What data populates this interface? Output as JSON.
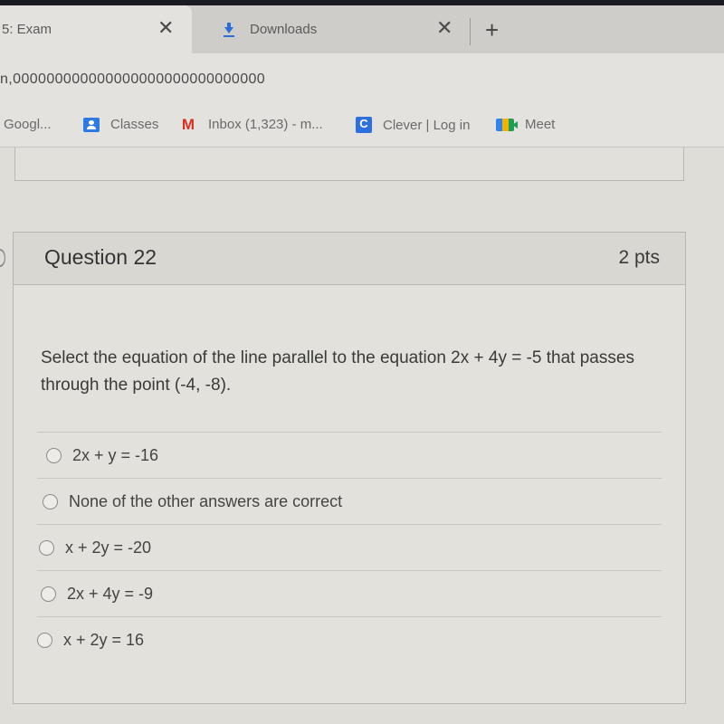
{
  "browser": {
    "tabs": [
      {
        "title": "5: Exam",
        "active": true
      },
      {
        "title": "Downloads",
        "icon": "download-icon",
        "active": false
      }
    ],
    "close_glyph": "✕",
    "new_tab_glyph": "+",
    "url": "n,000000000000000000000000000000"
  },
  "bookmarks": [
    {
      "label": "Googl...",
      "icon": null
    },
    {
      "label": "Classes",
      "icon": "google-classroom-icon"
    },
    {
      "label": "Inbox (1,323) - m...",
      "icon": "gmail-icon",
      "glyph": "M"
    },
    {
      "label": "Clever | Log in",
      "icon": "clever-icon",
      "glyph": "C"
    },
    {
      "label": "Meet",
      "icon": "google-meet-icon"
    }
  ],
  "question": {
    "title": "Question 22",
    "points": "2 pts",
    "text": "Select the equation of the line parallel to the equation  2x + 4y = -5  that passes through the point (-4, -8).",
    "answers": [
      {
        "label": "2x + y = -16",
        "selected": false
      },
      {
        "label": "None of the other answers are correct",
        "selected": false
      },
      {
        "label": "x + 2y = -20",
        "selected": false
      },
      {
        "label": "2x + 4y = -9",
        "selected": false
      },
      {
        "label": "x + 2y = 16",
        "selected": false
      }
    ]
  }
}
